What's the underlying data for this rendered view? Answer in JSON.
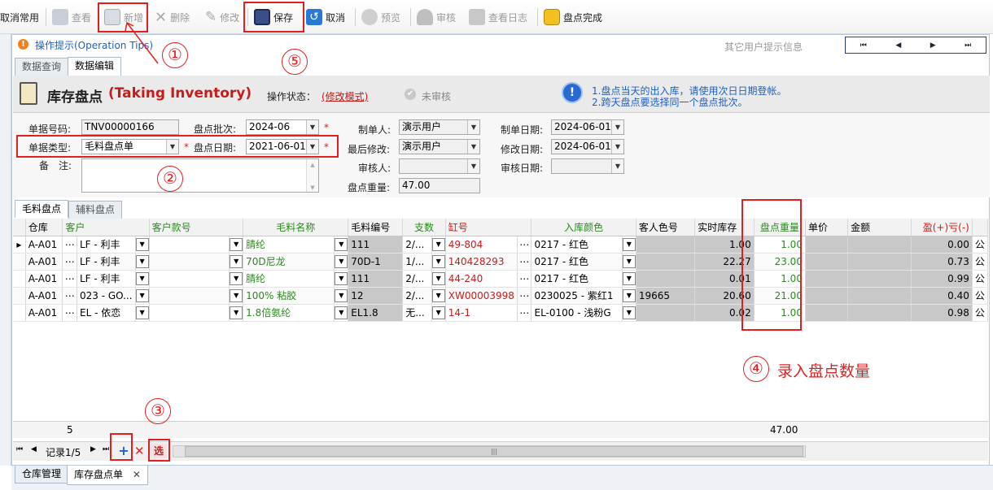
{
  "toolbar": {
    "cancel_common": "取消常用",
    "view": "查看",
    "add": "新增",
    "delete": "删除",
    "edit": "修改",
    "save": "保存",
    "cancel": "取消",
    "preview": "预览",
    "audit": "审核",
    "view_log": "查看日志",
    "inventory_done": "盘点完成"
  },
  "tip": {
    "label": "操作提示(Operation Tips)",
    "other_user_info": "其它用户提示信息"
  },
  "pager_top": [
    "⏮",
    "◀",
    "▶",
    "⏭"
  ],
  "tabs": [
    "数据查询",
    "数据编辑"
  ],
  "form": {
    "title": "库存盘点",
    "title_en": "(Taking Inventory)",
    "op_status_label": "操作状态：",
    "op_status_value": "(修改模式)",
    "audit_status": "未审核",
    "notice_line1": "1.盘点当天的出入库，请使用次日日期登帐。",
    "notice_line2": "2.跨天盘点要选择同一个盘点批次。",
    "doc_no_label": "单据号码:",
    "doc_no": "TNV00000166",
    "batch_label": "盘点批次:",
    "batch": "2024-06",
    "doc_type_label": "单据类型:",
    "doc_type": "毛料盘点单",
    "date_label": "盘点日期:",
    "date": "2021-06-01",
    "remark_label": "备　注:",
    "creator_label": "制单人:",
    "creator": "演示用户",
    "modifier_label": "最后修改:",
    "modifier": "演示用户",
    "auditor_label": "审核人:",
    "auditor": "",
    "weight_label": "盘点重量:",
    "weight": "47.00",
    "create_date_label": "制单日期:",
    "create_date": "2024-06-01",
    "modify_date_label": "修改日期:",
    "modify_date": "2024-06-01",
    "audit_date_label": "审核日期:",
    "audit_date": ""
  },
  "subtabs": [
    "毛料盘点",
    "辅料盘点"
  ],
  "table": {
    "headers": [
      "仓库",
      "客户",
      "客户款号",
      "毛料名称",
      "毛料编号",
      "支数",
      "缸号",
      "入库颜色",
      "客人色号",
      "实时库存",
      "盘点重量",
      "单价",
      "金额",
      "盈(+)亏(-)"
    ],
    "rows": [
      {
        "wh": "A-A01",
        "cust": "LF - 利丰",
        "style": "",
        "name": "腈纶",
        "code": "111",
        "count": "2/...",
        "lot": "49-804",
        "color": "0217 - 红色",
        "cust_color": "",
        "stock": "1.00",
        "weight": "1.00",
        "price": "",
        "amount": "",
        "diff": "0.00",
        "extra": "公"
      },
      {
        "wh": "A-A01",
        "cust": "LF - 利丰",
        "style": "",
        "name": "70D尼龙",
        "code": "70D-1",
        "count": "1/...",
        "lot": "140428293",
        "color": "0217 - 红色",
        "cust_color": "",
        "stock": "22.27",
        "weight": "23.00",
        "price": "",
        "amount": "",
        "diff": "0.73",
        "extra": "公"
      },
      {
        "wh": "A-A01",
        "cust": "LF - 利丰",
        "style": "",
        "name": "腈纶",
        "code": "111",
        "count": "2/...",
        "lot": "44-240",
        "color": "0217 - 红色",
        "cust_color": "",
        "stock": "0.01",
        "weight": "1.00",
        "price": "",
        "amount": "",
        "diff": "0.99",
        "extra": "公"
      },
      {
        "wh": "A-A01",
        "cust": "023 - GO...",
        "style": "",
        "name": "100% 粘胶",
        "code": "12",
        "count": "2/...",
        "lot": "XW00003998",
        "color": "0230025 - 紫红1",
        "cust_color": "19665",
        "stock": "20.60",
        "weight": "21.00",
        "price": "",
        "amount": "",
        "diff": "0.40",
        "extra": "公"
      },
      {
        "wh": "A-A01",
        "cust": "EL - 依恋",
        "style": "",
        "name": "1.8倍氨纶",
        "code": "EL1.8",
        "count": "无...",
        "lot": "14-1",
        "color": "EL-0100 - 浅粉G",
        "cust_color": "",
        "stock": "0.02",
        "weight": "1.00",
        "price": "",
        "amount": "",
        "diff": "0.98",
        "extra": "公"
      }
    ],
    "footer_count": "5",
    "footer_weight": "47.00"
  },
  "nav": {
    "record": "记录1/5",
    "pick": "选"
  },
  "annotations": {
    "c1": "①",
    "c2": "②",
    "c3": "③",
    "c4": "④",
    "c5": "⑤",
    "c4_text": "录入盘点数量"
  },
  "bottom_tabs": [
    "仓库管理",
    "库存盘点单"
  ],
  "close_glyph": "✕"
}
